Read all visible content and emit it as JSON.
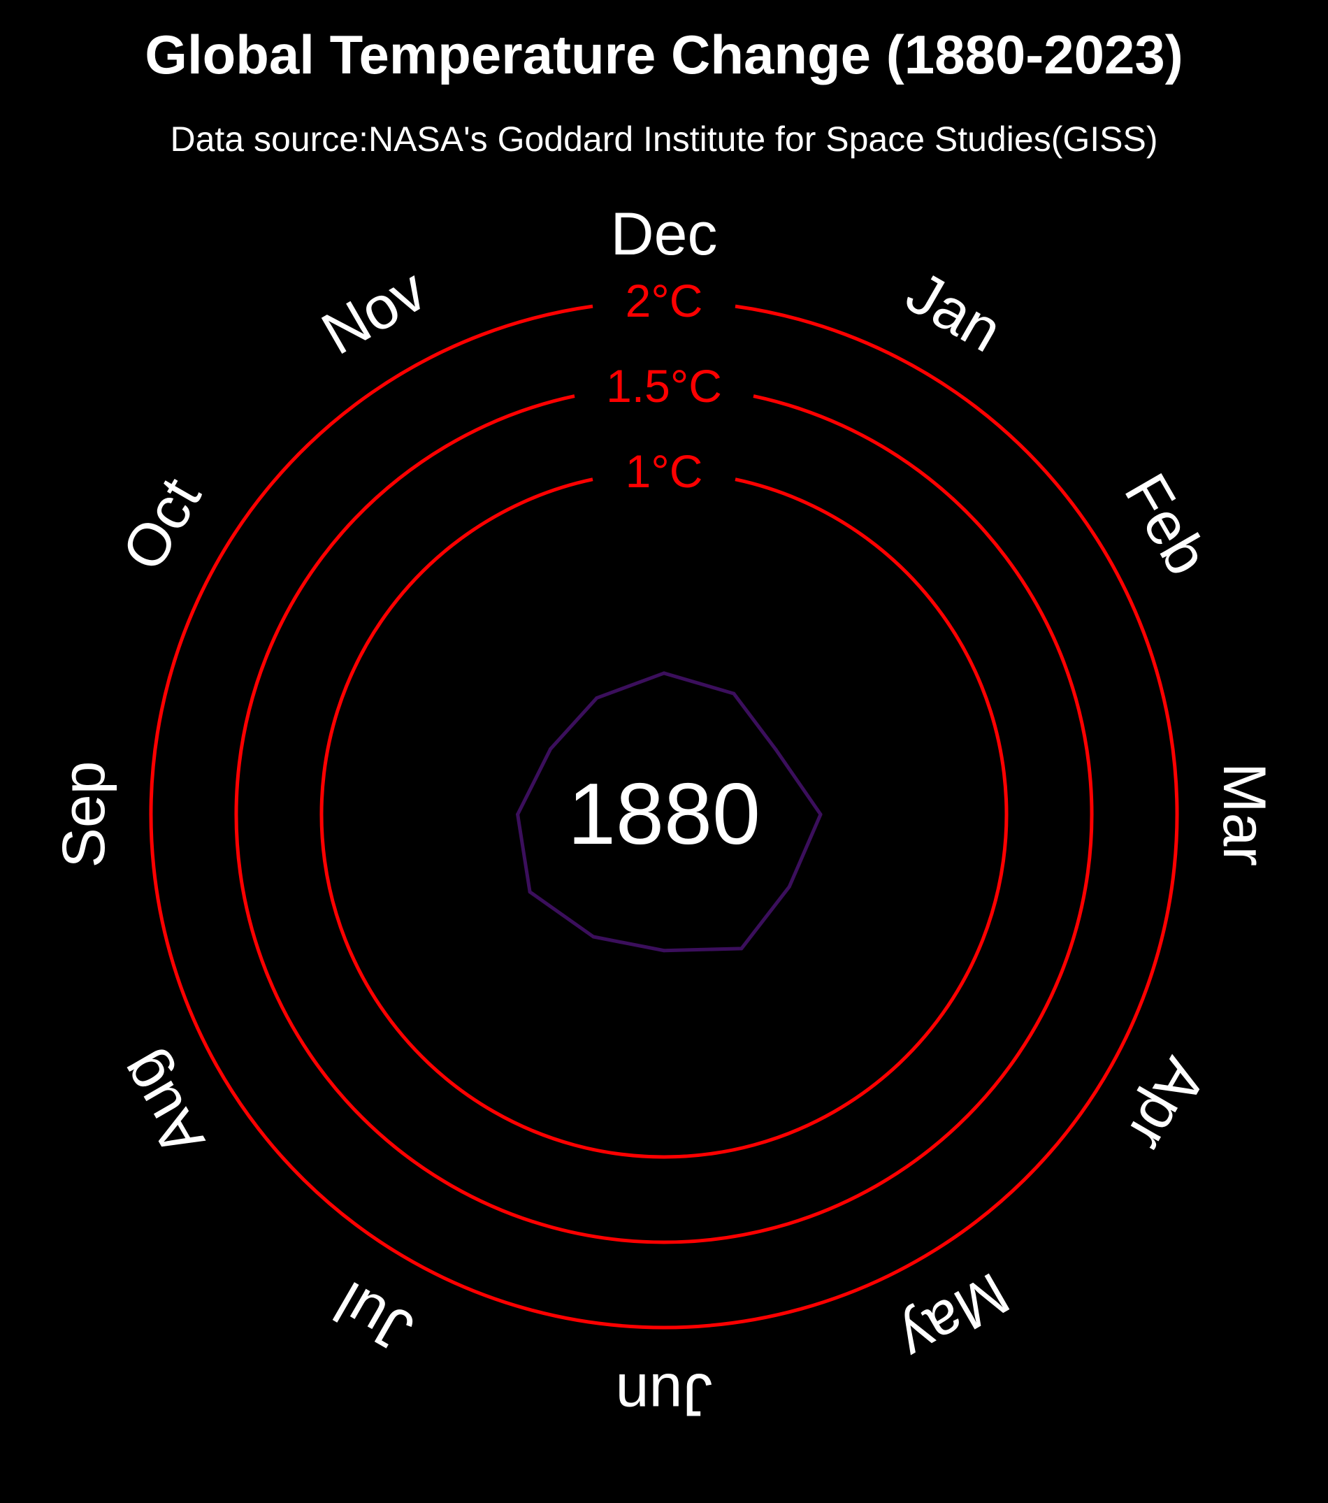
{
  "chart_data": {
    "type": "line",
    "subtype": "polar-climate-spiral",
    "title": "Global Temperature Change (1880-2023)",
    "subtitle": "Data source:NASA's Goddard Institute for Space Studies(GISS)",
    "year": "1880",
    "months": [
      "Jan",
      "Feb",
      "Mar",
      "Apr",
      "May",
      "Jun",
      "Jul",
      "Aug",
      "Sep",
      "Oct",
      "Nov",
      "Dec"
    ],
    "reference_rings": [
      {
        "value": 1.0,
        "label": "1°C"
      },
      {
        "value": 1.5,
        "label": "1.5°C"
      },
      {
        "value": 2.0,
        "label": "2°C"
      }
    ],
    "series": [
      {
        "values": [
          -0.19,
          -0.25,
          -0.09,
          -0.16,
          -0.1,
          -0.21,
          -0.18,
          -0.1,
          -0.15,
          -0.24,
          -0.22,
          -0.18
        ]
      }
    ],
    "radial_range": [
      -1.0,
      2.0
    ],
    "grid": false
  },
  "colors": {
    "background": "#000000",
    "text": "#ffffff",
    "rings": "#ff0000",
    "series_line": "#3b0f5c"
  }
}
